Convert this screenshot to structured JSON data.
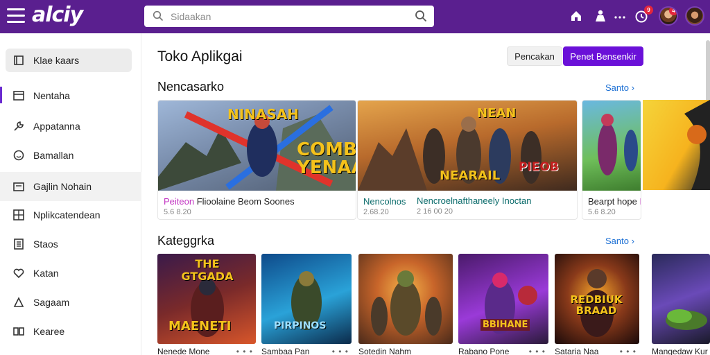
{
  "header": {
    "logo": "alciy",
    "search_placeholder": "Sidaakan",
    "notification_count": "9",
    "avatar_badge": "4"
  },
  "sidebar": {
    "items": [
      {
        "label": "Klae kaars",
        "icon": "library-icon"
      },
      {
        "label": "Nentaha",
        "icon": "window-icon"
      },
      {
        "label": "Appatanna",
        "icon": "wrench-icon"
      },
      {
        "label": "Bamallan",
        "icon": "smiley-icon"
      },
      {
        "label": "Gajlin Nohain",
        "icon": "wallet-icon"
      },
      {
        "label": "Nplikcatendean",
        "icon": "grid-icon"
      },
      {
        "label": "Staos",
        "icon": "list-icon"
      },
      {
        "label": "Katan",
        "icon": "heart-icon"
      },
      {
        "label": "Sagaam",
        "icon": "triangle-icon"
      },
      {
        "label": "Kearee",
        "icon": "columns-icon"
      }
    ]
  },
  "main": {
    "title": "Toko Aplikgai",
    "btn_secondary": "Pencakan",
    "btn_primary": "Penet Bensenkir",
    "featured": {
      "title": "Nencasarko",
      "see_all": "Santo",
      "cards": [
        {
          "art_title": "NINASAH",
          "art_text": "COMBS YENAAK",
          "title_accent": "Peiteon",
          "title_rest": "Flioolaine Beom Soones",
          "sub": "5.6 8.20"
        },
        {
          "art_title": "NEAN",
          "art_text": "NEARAIL",
          "art_text2": "PIEOB",
          "title": "Nencolnos",
          "sub": "2.68.20"
        },
        {
          "title": "Nencroelnafthaneely Inoctan",
          "sub": "2 16 00 20"
        },
        {
          "title": "Bearpt hope",
          "title_accent": "Rb",
          "sub": "5.6 8.20"
        }
      ]
    },
    "categories": {
      "title": "Kateggrka",
      "see_all": "Santo",
      "cards": [
        {
          "art_title": "THE GTGADA",
          "art_text": "MAENETI",
          "title": "Nenede Mone"
        },
        {
          "art_text": "PIRPINOS",
          "title": "Sambaa Pan"
        },
        {
          "title": "Sotedin Nahm"
        },
        {
          "art_text": "BBIHANE",
          "title": "Rabano Pone"
        },
        {
          "art_text": "REDBIUK BRAAD",
          "title": "Sataria Naa"
        },
        {
          "title": "Mangedaw Kur"
        }
      ]
    }
  }
}
